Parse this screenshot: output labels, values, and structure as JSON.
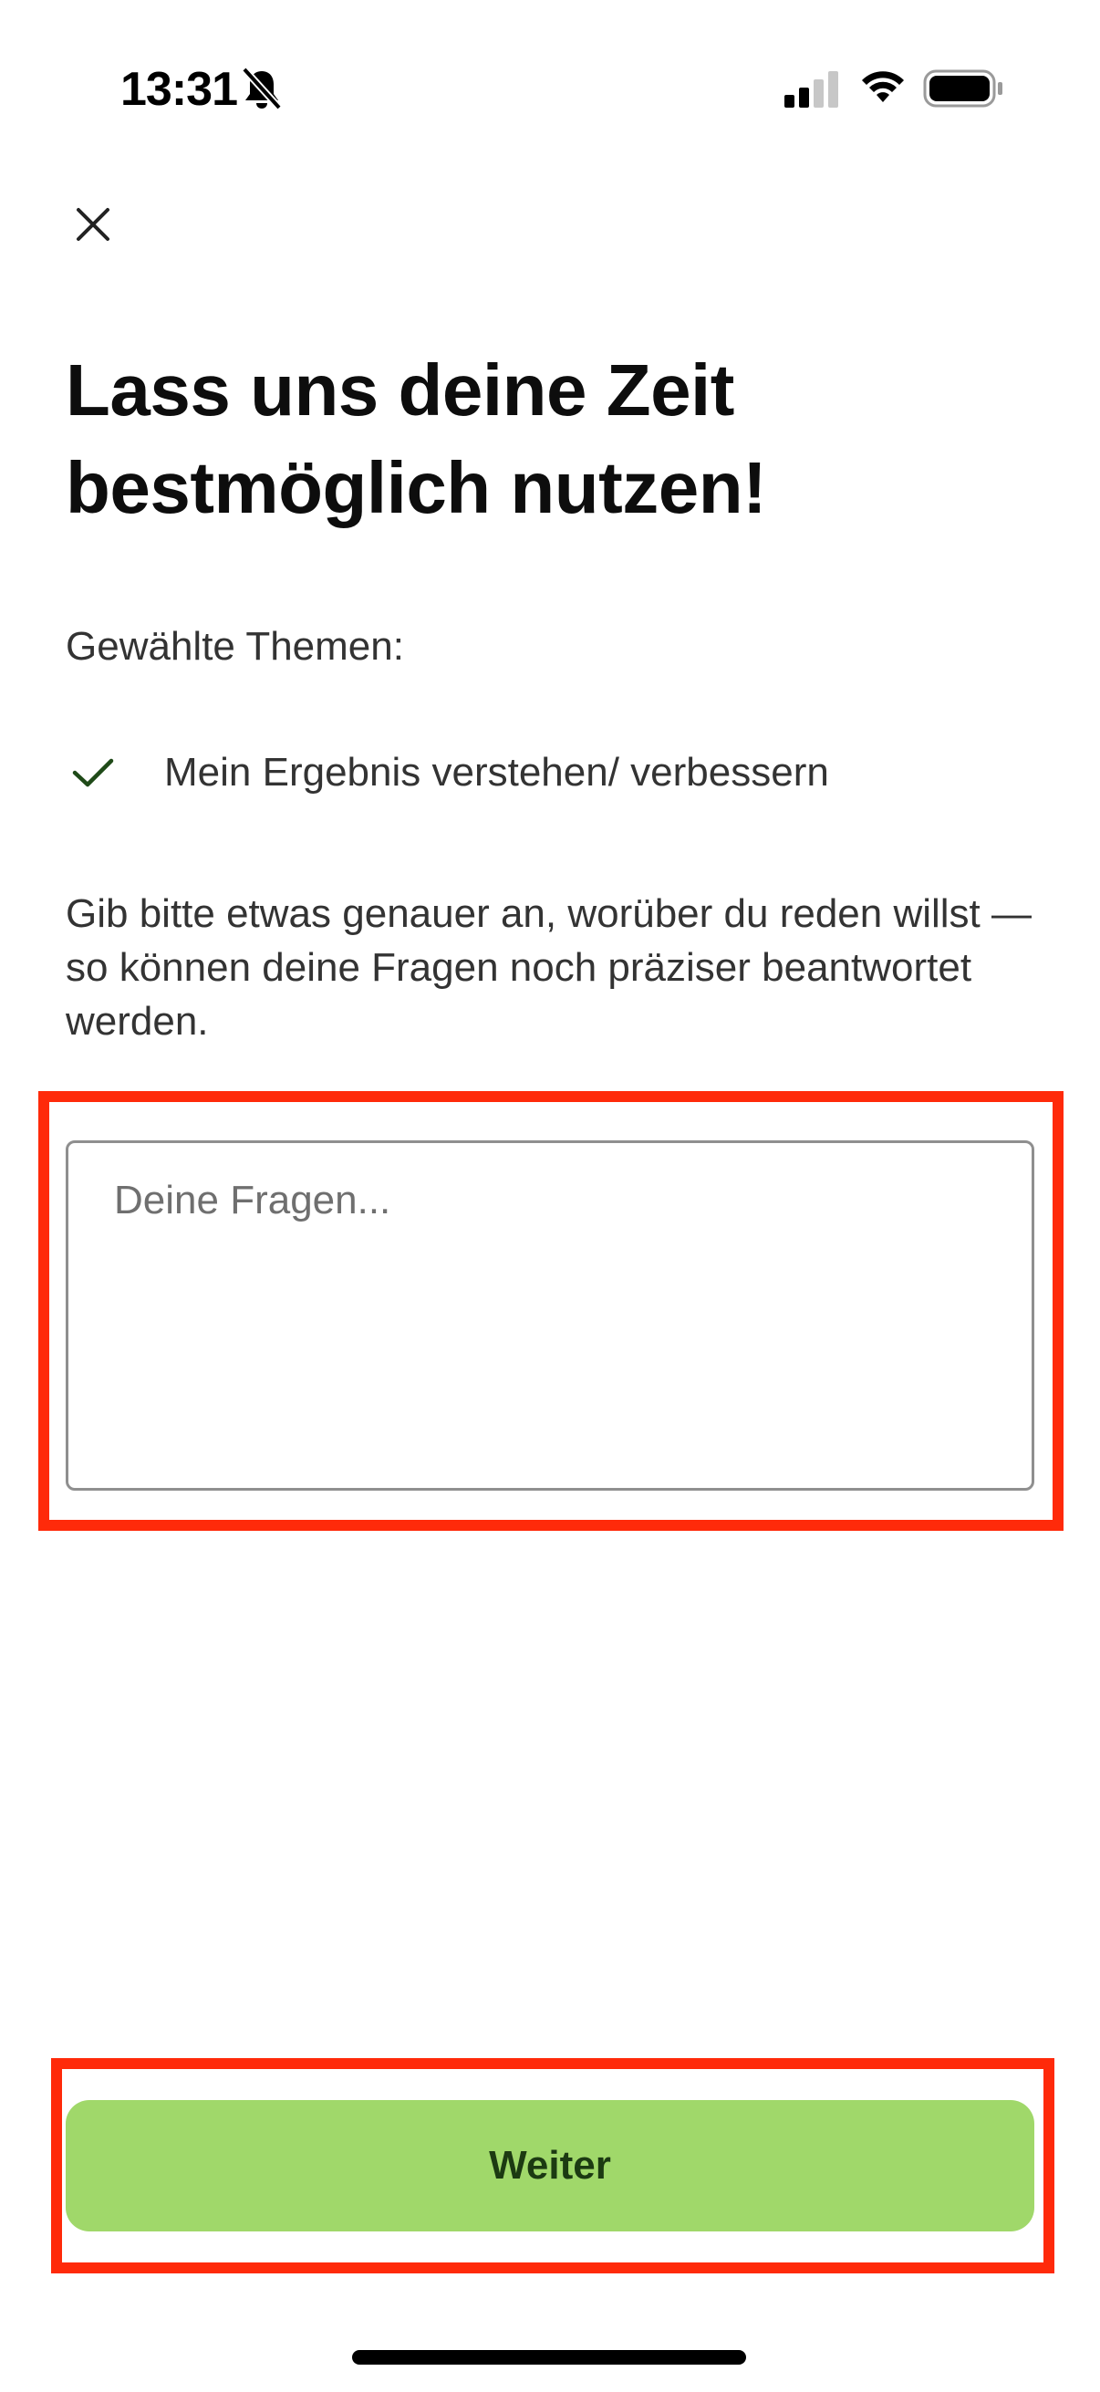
{
  "status_bar": {
    "time": "13:31",
    "icons": [
      "bell-slash-icon",
      "cellular-signal-icon",
      "wifi-icon",
      "battery-icon"
    ]
  },
  "header": {
    "close_icon": "close-icon"
  },
  "main": {
    "title": "Lass uns deine Zeit bestmöglich nutzen!",
    "topics_heading": "Gewählte Themen:",
    "topics": [
      {
        "label": "Mein Ergebnis verstehen/ verbessern",
        "icon": "check-icon"
      }
    ],
    "instructions": "Gib bitte etwas genauer an, worüber du reden willst — so können deine Fragen noch präziser beantwortet werden.",
    "questions_input": {
      "placeholder": "Deine Fragen...",
      "value": ""
    }
  },
  "footer": {
    "continue_label": "Weiter"
  },
  "colors": {
    "accent_button": "#a0d86a",
    "button_text": "#1c3a12",
    "check_icon": "#1f4a18",
    "highlight": "#ff2a0a"
  }
}
